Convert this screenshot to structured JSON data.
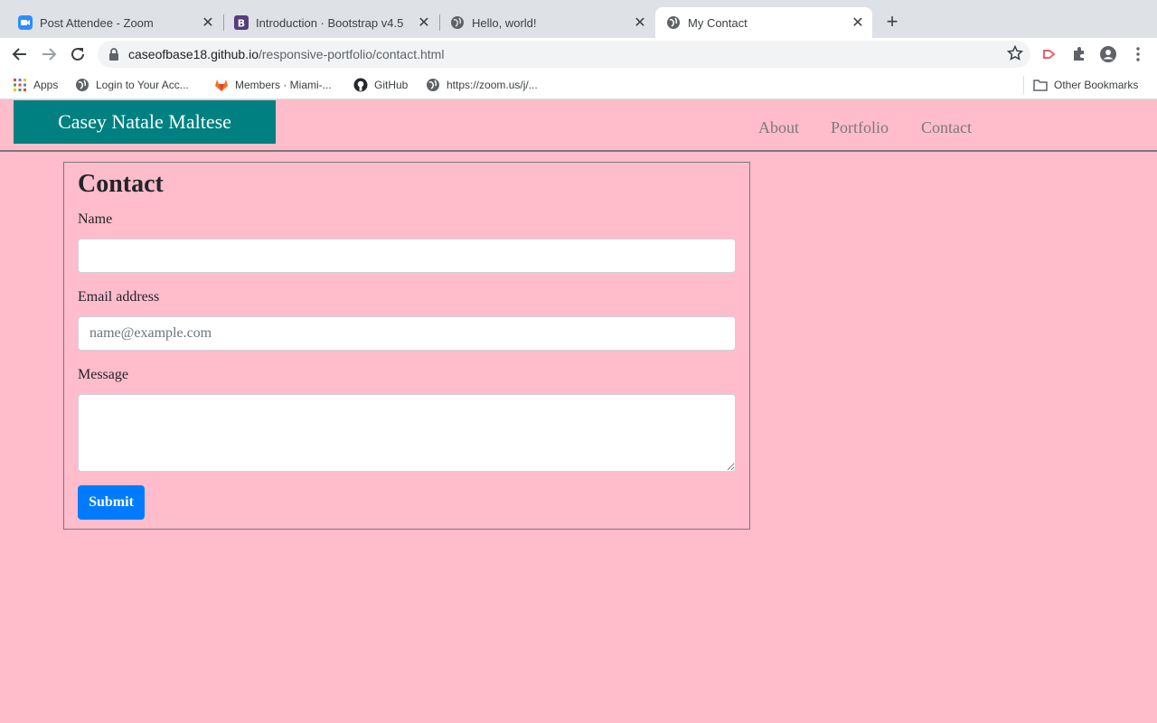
{
  "browser": {
    "tabs": [
      {
        "title": "Post Attendee - Zoom",
        "icon": "zoom-icon"
      },
      {
        "title": "Introduction · Bootstrap v4.5",
        "icon": "bootstrap-icon"
      },
      {
        "title": "Hello, world!",
        "icon": "globe-icon"
      },
      {
        "title": "My Contact",
        "icon": "globe-icon",
        "active": true
      }
    ],
    "url_host": "caseofbase18.github.io",
    "url_path": "/responsive-portfolio/contact.html",
    "bookmarks": [
      {
        "label": "Apps",
        "icon": "apps-grid-icon"
      },
      {
        "label": "Login to Your Acc...",
        "icon": "globe-icon"
      },
      {
        "label": "Members · Miami-...",
        "icon": "gitlab-icon"
      },
      {
        "label": "GitHub",
        "icon": "github-icon"
      },
      {
        "label": "https://zoom.us/j/...",
        "icon": "globe-icon"
      }
    ],
    "other_bookmarks": "Other Bookmarks"
  },
  "site": {
    "brand": "Casey Natale Maltese",
    "nav": [
      "About",
      "Portfolio",
      "Contact"
    ],
    "accent_color": "#008080",
    "background_color": "#ffbccb"
  },
  "form": {
    "heading": "Contact",
    "name_label": "Name",
    "name_value": "",
    "email_label": "Email address",
    "email_placeholder": "name@example.com",
    "message_label": "Message",
    "message_value": "",
    "submit_label": "Submit",
    "submit_color": "#007bff"
  }
}
